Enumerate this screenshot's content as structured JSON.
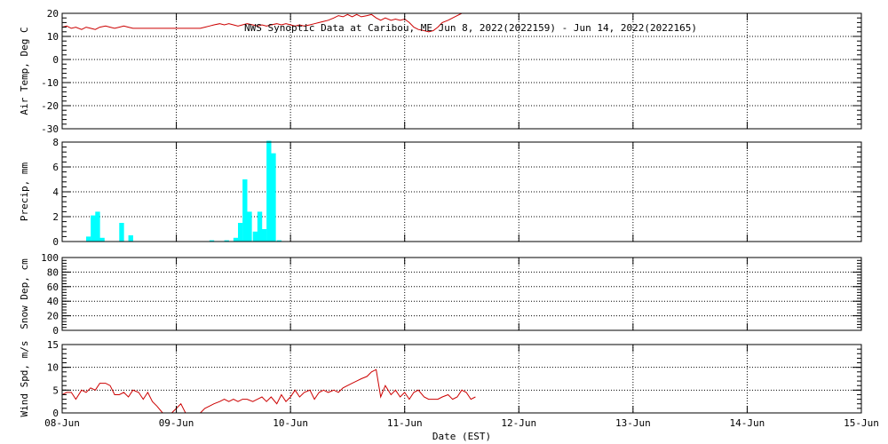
{
  "title": "NWS Synoptic Data at Caribou, ME   Jun  8, 2022(2022159) - Jun 14, 2022(2022165)",
  "xlabel": "Date (EST)",
  "x_tick_labels": [
    "08-Jun",
    "09-Jun",
    "10-Jun",
    "11-Jun",
    "12-Jun",
    "13-Jun",
    "14-Jun",
    "15-Jun"
  ],
  "chart_data": [
    {
      "type": "line",
      "ylabel": "Air Temp, Deg C",
      "ylim": [
        -30,
        20
      ],
      "yticks": [
        -30,
        -20,
        -10,
        0,
        10,
        20
      ],
      "color": "#cc0000",
      "x_unit": "days since 08-Jun",
      "x": [
        0,
        0.04,
        0.08,
        0.12,
        0.17,
        0.21,
        0.25,
        0.29,
        0.33,
        0.38,
        0.42,
        0.46,
        0.5,
        0.54,
        0.58,
        0.62,
        0.67,
        0.71,
        0.75,
        0.79,
        0.83,
        0.88,
        0.92,
        0.96,
        1.0,
        1.04,
        1.08,
        1.12,
        1.17,
        1.21,
        1.25,
        1.29,
        1.33,
        1.38,
        1.42,
        1.46,
        1.5,
        1.54,
        1.58,
        1.62,
        1.67,
        1.71,
        1.75,
        1.79,
        1.83,
        1.88,
        1.92,
        1.96,
        2.0,
        2.04,
        2.08,
        2.12,
        2.17,
        2.21,
        2.25,
        2.29,
        2.33,
        2.38,
        2.42,
        2.46,
        2.5,
        2.54,
        2.58,
        2.62,
        2.67,
        2.71,
        2.75,
        2.79,
        2.83,
        2.88,
        2.92,
        2.96,
        3.0,
        3.04,
        3.08,
        3.12,
        3.17,
        3.21,
        3.25,
        3.29,
        3.33,
        3.38,
        3.42,
        3.46,
        3.5,
        3.54,
        3.58,
        3.62
      ],
      "y": [
        14,
        14.5,
        13.5,
        14,
        13,
        14,
        13.5,
        13,
        14,
        14.5,
        14,
        13.5,
        14,
        14.5,
        14,
        13.5,
        13.5,
        13.5,
        13.5,
        13.5,
        13.5,
        13.5,
        13.5,
        13.5,
        13.5,
        13.5,
        13.5,
        13.5,
        13.5,
        13.5,
        14,
        14.5,
        15,
        15.5,
        15,
        15.5,
        15,
        14.5,
        15,
        15.5,
        15,
        14.5,
        15,
        14.5,
        15,
        15.5,
        15,
        15.5,
        15,
        14.5,
        15,
        14.5,
        15,
        15.5,
        16,
        16.5,
        17,
        18,
        19,
        18.5,
        19.5,
        18.5,
        19.5,
        18.5,
        19,
        19.5,
        18,
        17,
        18,
        17,
        17.5,
        17,
        17.5,
        16,
        14,
        13,
        12.5,
        12,
        12.5,
        14,
        16,
        17,
        18,
        19,
        20,
        20.5,
        21,
        22
      ]
    },
    {
      "type": "bar",
      "ylabel": "Precip, mm",
      "ylim": [
        0,
        8
      ],
      "yticks": [
        0,
        2,
        4,
        6,
        8
      ],
      "color": "#00ffff",
      "x_unit": "days since 08-Jun",
      "x": [
        0.21,
        0.25,
        0.29,
        0.33,
        0.46,
        0.5,
        0.58,
        0.62,
        1.29,
        1.42,
        1.5,
        1.54,
        1.58,
        1.62,
        1.67,
        1.71,
        1.75,
        1.79,
        1.83,
        1.88,
        1.92,
        1.96
      ],
      "values": [
        0.4,
        2.1,
        2.4,
        0.3,
        0,
        1.5,
        0.5,
        0,
        0.1,
        0.1,
        0.3,
        1.5,
        5.0,
        2.4,
        0.8,
        2.4,
        1.0,
        8.1,
        7.1,
        0.1,
        0,
        0
      ]
    },
    {
      "type": "line",
      "ylabel": "Snow Dep, cm",
      "ylim": [
        0,
        100
      ],
      "yticks": [
        0,
        20,
        40,
        60,
        80,
        100
      ],
      "x": [],
      "y": []
    },
    {
      "type": "line",
      "ylabel": "Wind Spd, m/s",
      "ylim": [
        0,
        15
      ],
      "yticks": [
        0,
        5,
        10,
        15
      ],
      "color": "#cc0000",
      "x_unit": "days since 08-Jun",
      "x": [
        0,
        0.04,
        0.08,
        0.12,
        0.17,
        0.21,
        0.25,
        0.29,
        0.33,
        0.38,
        0.42,
        0.46,
        0.5,
        0.54,
        0.58,
        0.62,
        0.67,
        0.71,
        0.75,
        0.79,
        0.83,
        0.88,
        0.92,
        0.96,
        1.0,
        1.04,
        1.08,
        1.12,
        1.17,
        1.21,
        1.25,
        1.29,
        1.33,
        1.38,
        1.42,
        1.46,
        1.5,
        1.54,
        1.58,
        1.62,
        1.67,
        1.71,
        1.75,
        1.79,
        1.83,
        1.88,
        1.92,
        1.96,
        2.0,
        2.04,
        2.08,
        2.12,
        2.17,
        2.21,
        2.25,
        2.29,
        2.33,
        2.38,
        2.42,
        2.46,
        2.5,
        2.54,
        2.58,
        2.62,
        2.67,
        2.71,
        2.75,
        2.79,
        2.83,
        2.88,
        2.92,
        2.96,
        3.0,
        3.04,
        3.08,
        3.12,
        3.17,
        3.21,
        3.25,
        3.29,
        3.33,
        3.38,
        3.42,
        3.46,
        3.5,
        3.54,
        3.58,
        3.62
      ],
      "y": [
        4,
        4.5,
        4.5,
        3,
        5,
        4.5,
        5.5,
        5,
        6.5,
        6.5,
        6,
        4,
        4,
        4.5,
        3.5,
        5,
        4.5,
        3,
        4.5,
        2.5,
        1.5,
        0,
        0,
        0,
        1,
        2,
        0,
        0,
        0,
        0,
        1,
        1.5,
        2,
        2.5,
        3,
        2.5,
        3,
        2.5,
        3,
        3,
        2.5,
        3,
        3.5,
        2.5,
        3.5,
        2,
        4,
        2.5,
        3.5,
        5,
        3.5,
        4.5,
        5,
        3,
        4.5,
        5,
        4.5,
        5,
        4.5,
        5.5,
        6,
        6.5,
        7,
        7.5,
        8,
        9,
        9.5,
        3.5,
        6,
        4,
        5,
        3.5,
        4.5,
        3,
        4.5,
        5,
        3.5,
        3,
        3,
        3,
        3.5,
        4,
        3,
        3.5,
        5,
        4.5,
        3,
        3.5
      ]
    }
  ]
}
